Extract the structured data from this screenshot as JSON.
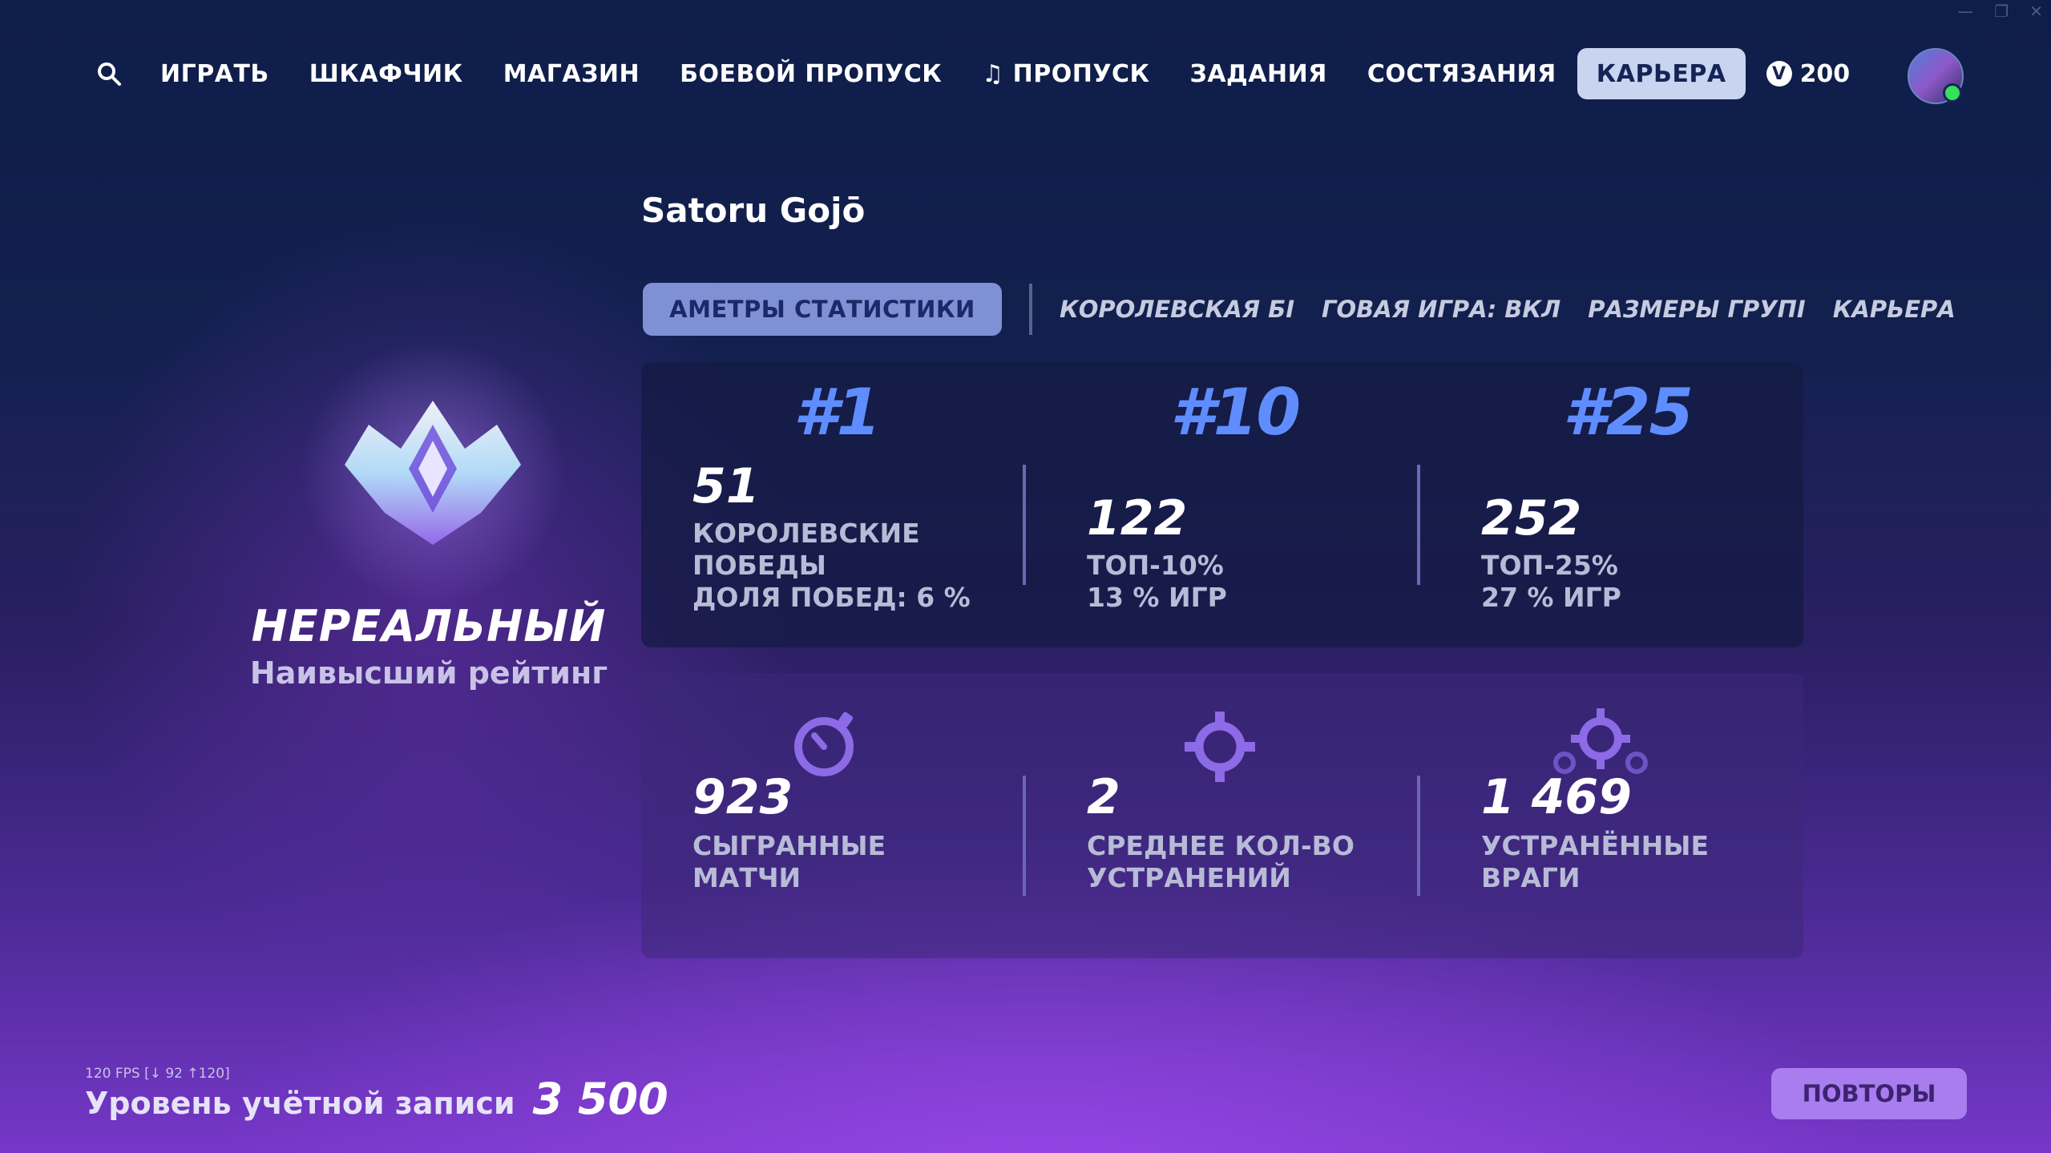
{
  "nav": {
    "items": [
      "ИГРАТЬ",
      "ШКАФЧИК",
      "МАГАЗИН",
      "БОЕВОЙ ПРОПУСК",
      "♫ ПРОПУСК",
      "ЗАДАНИЯ",
      "СОСТЯЗАНИЯ"
    ],
    "active": "КАРЬЕРА",
    "vbucks_icon_letter": "V",
    "vbucks": "200"
  },
  "player_name": "Satoru Gojō",
  "stat_tabs": {
    "active": "АМЕТРЫ СТАТИСТИКИ",
    "others": [
      "КОРОЛЕВСКАЯ БІ",
      "ГОВАЯ ИГРА: ВКЛ",
      "РАЗМЕРЫ ГРУПІ",
      "КАРЬЕРА"
    ]
  },
  "rank": {
    "title": "НЕРЕАЛЬНЫЙ",
    "subtitle": "Наивысший рейтинг"
  },
  "placements": [
    {
      "place": "#1",
      "value": "51",
      "label1": "КОРОЛЕВСКИЕ",
      "label2": "ПОБЕДЫ",
      "label3": "ДОЛЯ ПОБЕД: 6 %"
    },
    {
      "place": "#10",
      "value": "122",
      "label1": "ТОП-10%",
      "label2": "13 % ИГР"
    },
    {
      "place": "#25",
      "value": "252",
      "label1": "ТОП-25%",
      "label2": "27 % ИГР"
    }
  ],
  "totals": [
    {
      "icon": "stopwatch-icon",
      "value": "923",
      "label1": "СЫГРАННЫЕ",
      "label2": "МАТЧИ"
    },
    {
      "icon": "crosshair-icon",
      "value": "2",
      "label1": "СРЕДНЕЕ КОЛ-ВО",
      "label2": "УСТРАНЕНИЙ"
    },
    {
      "icon": "multi-crosshair-icon",
      "value": "1 469",
      "label1": "УСТРАНЁННЫЕ",
      "label2": "ВРАГИ"
    }
  ],
  "fps_overlay": "120 FPS [↓ 92 ↑120]",
  "account": {
    "label": "Уровень учётной записи",
    "level": "3 500"
  },
  "replays_label": "ПОВТОРЫ",
  "colors": {
    "accent_blue": "#5f8dff",
    "active_tab": "#c9d4f0",
    "replays": "#a97df0",
    "online": "#35e05a"
  }
}
